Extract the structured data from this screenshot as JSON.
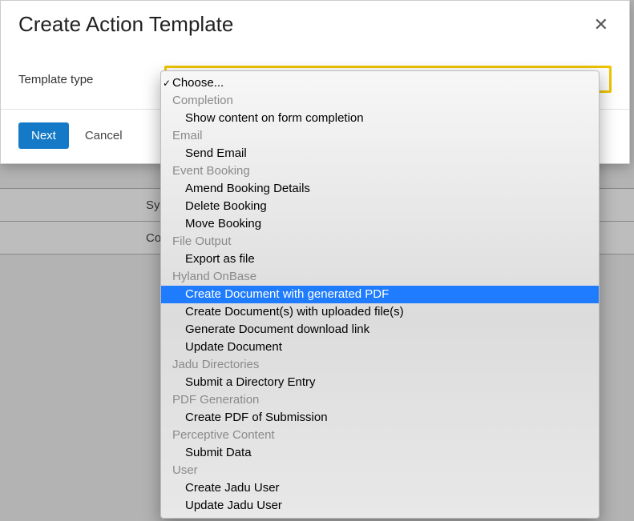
{
  "background": {
    "row1": "Sy",
    "row2": "Co"
  },
  "modal": {
    "title": "Create Action Template",
    "label_template_type": "Template type",
    "selected_value": "Choose...",
    "btn_next": "Next",
    "btn_cancel": "Cancel"
  },
  "dropdown": {
    "choose": "Choose...",
    "groups": [
      {
        "label": "Completion",
        "items": [
          "Show content on form completion"
        ]
      },
      {
        "label": "Email",
        "items": [
          "Send Email"
        ]
      },
      {
        "label": "Event Booking",
        "items": [
          "Amend Booking Details",
          "Delete Booking",
          "Move Booking"
        ]
      },
      {
        "label": "File Output",
        "items": [
          "Export as file"
        ]
      },
      {
        "label": "Hyland OnBase",
        "items": [
          "Create Document with generated PDF",
          "Create Document(s) with uploaded file(s)",
          "Generate Document download link",
          "Update Document"
        ]
      },
      {
        "label": "Jadu Directories",
        "items": [
          "Submit a Directory Entry"
        ]
      },
      {
        "label": "PDF Generation",
        "items": [
          "Create PDF of Submission"
        ]
      },
      {
        "label": "Perceptive Content",
        "items": [
          "Submit Data"
        ]
      },
      {
        "label": "User",
        "items": [
          "Create Jadu User",
          "Update Jadu User"
        ]
      }
    ],
    "highlighted": "Create Document with generated PDF"
  }
}
